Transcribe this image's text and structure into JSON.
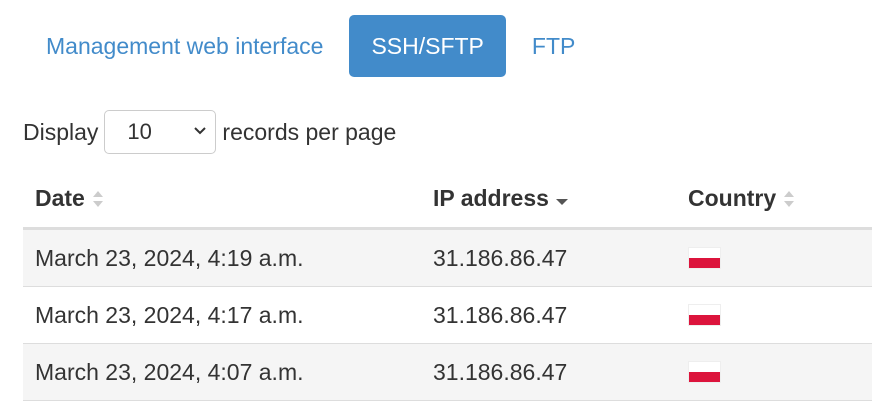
{
  "tabs": [
    {
      "label": "Management web interface",
      "active": false
    },
    {
      "label": "SSH/SFTP",
      "active": true
    },
    {
      "label": "FTP",
      "active": false
    }
  ],
  "length_control": {
    "prefix": "Display",
    "selected": "10",
    "suffix": "records per page"
  },
  "table": {
    "columns": [
      {
        "label": "Date",
        "sort": "none",
        "icon": "sort-both-icon"
      },
      {
        "label": "IP address",
        "sort": "descending",
        "icon": "sort-desc-icon"
      },
      {
        "label": "Country",
        "sort": "none",
        "icon": "sort-both-icon"
      }
    ],
    "rows": [
      {
        "date": "March 23, 2024, 4:19 a.m.",
        "ip": "31.186.86.47",
        "flag": "poland-flag-icon"
      },
      {
        "date": "March 23, 2024, 4:17 a.m.",
        "ip": "31.186.86.47",
        "flag": "poland-flag-icon"
      },
      {
        "date": "March 23, 2024, 4:07 a.m.",
        "ip": "31.186.86.47",
        "flag": "poland-flag-icon"
      }
    ]
  },
  "colors": {
    "accent": "#428bca",
    "row_stripe": "#f5f5f5",
    "flag_white": "#ffffff",
    "flag_red": "#dc143c"
  }
}
